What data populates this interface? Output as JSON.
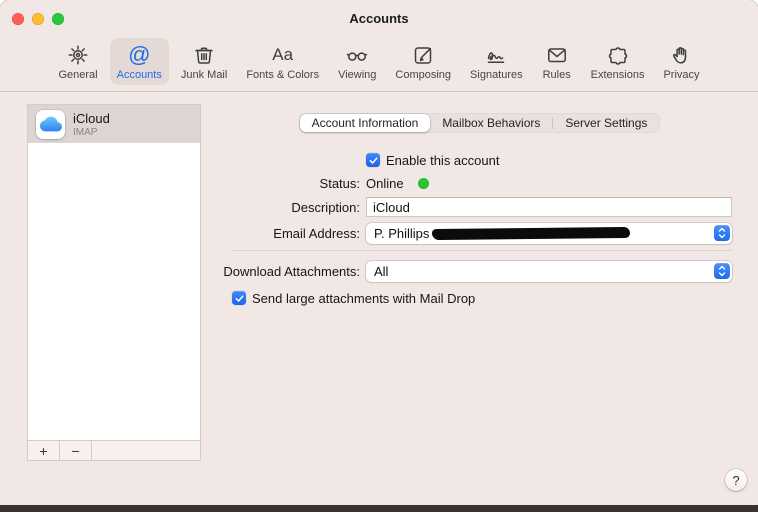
{
  "window": {
    "title": "Accounts",
    "help_label": "?"
  },
  "toolbar": {
    "items": [
      {
        "label": "General",
        "icon": "gear-icon",
        "selected": false
      },
      {
        "label": "Accounts",
        "icon": "at-icon",
        "selected": true
      },
      {
        "label": "Junk Mail",
        "icon": "trash-icon",
        "selected": false
      },
      {
        "label": "Fonts & Colors",
        "icon": "fonts-icon",
        "selected": false
      },
      {
        "label": "Viewing",
        "icon": "glasses-icon",
        "selected": false
      },
      {
        "label": "Composing",
        "icon": "compose-icon",
        "selected": false
      },
      {
        "label": "Signatures",
        "icon": "signature-icon",
        "selected": false
      },
      {
        "label": "Rules",
        "icon": "envelope-icon",
        "selected": false
      },
      {
        "label": "Extensions",
        "icon": "puzzle-icon",
        "selected": false
      },
      {
        "label": "Privacy",
        "icon": "hand-icon",
        "selected": false
      }
    ]
  },
  "sidebar": {
    "accounts": [
      {
        "name": "iCloud",
        "type": "IMAP",
        "selected": true
      }
    ],
    "add_label": "+",
    "remove_label": "−"
  },
  "tabs": [
    {
      "label": "Account Information",
      "selected": true
    },
    {
      "label": "Mailbox Behaviors",
      "selected": false
    },
    {
      "label": "Server Settings",
      "selected": false
    }
  ],
  "form": {
    "enable_label": "Enable this account",
    "enable_checked": true,
    "status_label": "Status:",
    "status_value": "Online",
    "status_color": "#28c732",
    "description_label": "Description:",
    "description_value": "iCloud",
    "email_label": "Email Address:",
    "email_value": "P. Phillips",
    "email_redacted": true,
    "download_label": "Download Attachments:",
    "download_value": "All",
    "maildrop_label": "Send large attachments with Mail Drop",
    "maildrop_checked": true
  },
  "colors": {
    "accent_blue": "#1f6ce8",
    "status_green": "#28c732",
    "selection_bg": "#dcd5d2",
    "window_bg": "#f1e8e5",
    "traffic_close": "#ff5f57",
    "traffic_minimize": "#febc2e",
    "traffic_zoom": "#28c840"
  }
}
